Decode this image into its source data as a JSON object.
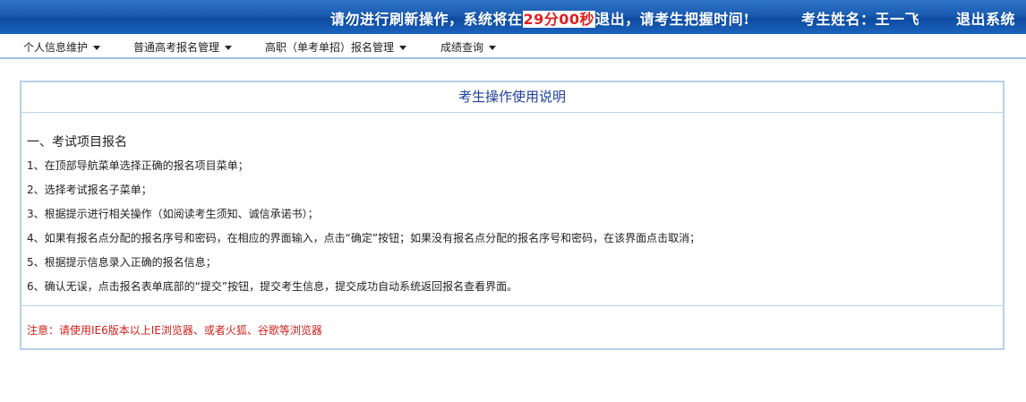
{
  "header": {
    "notice_prefix": "请勿进行刷新操作，系统将在",
    "countdown": "29分00秒",
    "notice_suffix": "退出，请考生把握时间!",
    "student_label": "考生姓名：",
    "student_name": "王一飞",
    "logout_label": "退出系统",
    "colors": {
      "bar": "#1a5bb0",
      "countdown": "#e02020"
    }
  },
  "nav": {
    "items": [
      {
        "label": "个人信息维护"
      },
      {
        "label": "普通高考报名管理"
      },
      {
        "label": "高职（单考单招）报名管理"
      },
      {
        "label": "成绩查询"
      }
    ]
  },
  "panel": {
    "title": "考生操作使用说明",
    "section_heading": "一、考试项目报名",
    "steps": [
      "1、在顶部导航菜单选择正确的报名项目菜单；",
      "2、选择考试报名子菜单；",
      "3、根据提示进行相关操作（如阅读考生须知、诚信承诺书）；",
      "4、如果有报名点分配的报名序号和密码，在相应的界面输入，点击“确定”按钮；如果没有报名点分配的报名序号和密码，在该界面点击取消；",
      "5、根据提示信息录入正确的报名信息；",
      "6、确认无误，点击报名表单底部的“提交”按钮，提交考生信息，提交成功自动系统返回报名查看界面。"
    ],
    "note": "注意：请使用IE6版本以上IE浏览器、或者火狐、谷歌等浏览器",
    "colors": {
      "title": "#1f3f9e",
      "note": "#d0201a",
      "border": "#b7d1ea"
    }
  }
}
